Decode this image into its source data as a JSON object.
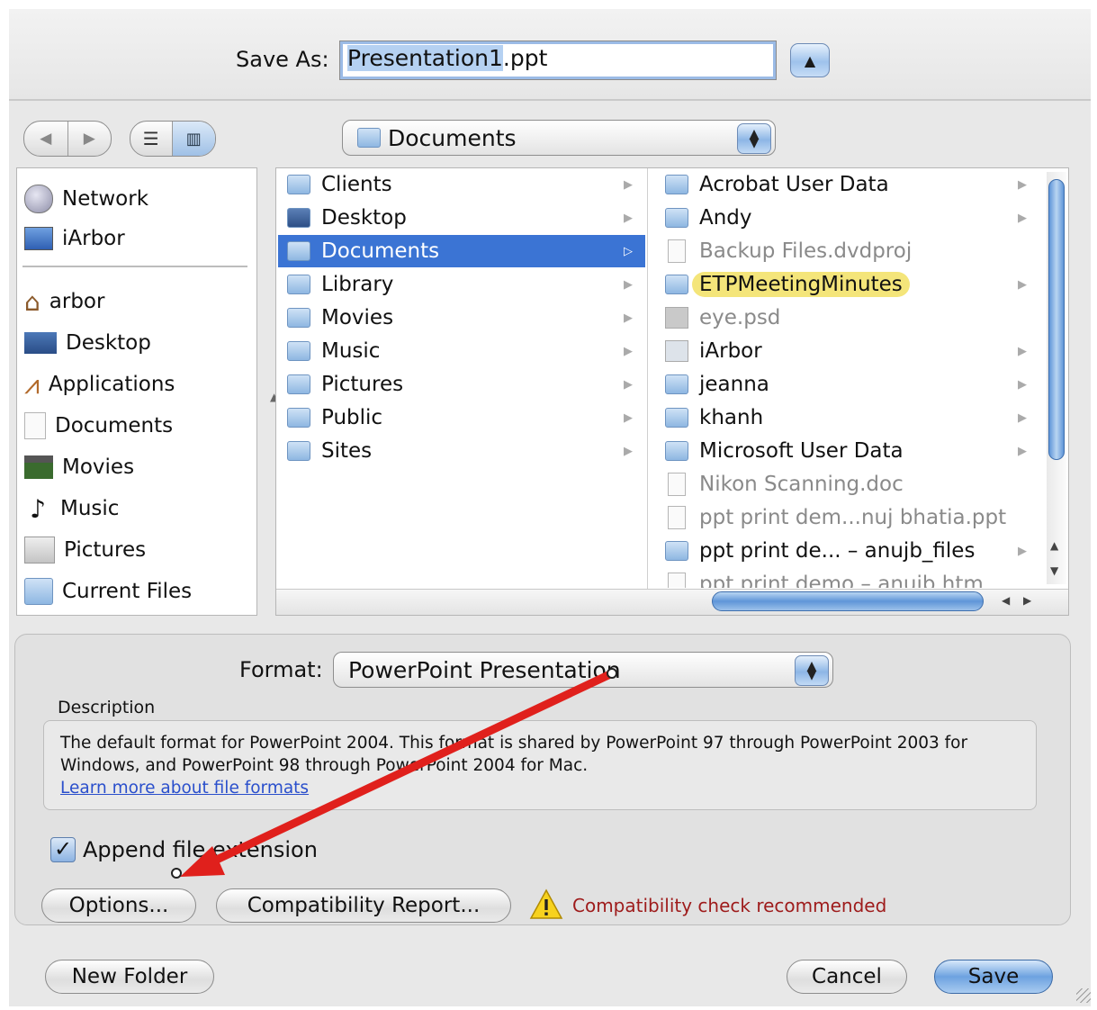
{
  "save_as": {
    "label": "Save As:",
    "filename_selected": "Presentation1",
    "filename_ext": ".ppt",
    "toggle_icon": "triangle-up-icon"
  },
  "toolbar": {
    "back_icon": "back-arrow-icon",
    "forward_icon": "forward-arrow-icon",
    "list_view_icon": "list-view-icon",
    "column_view_icon": "column-view-icon",
    "location": "Documents"
  },
  "sidebar": {
    "devices": [
      "Network",
      "iArbor"
    ],
    "places": [
      "arbor",
      "Desktop",
      "Applications",
      "Documents",
      "Movies",
      "Music",
      "Pictures",
      "Current Files"
    ]
  },
  "browser": {
    "column1": [
      "Clients",
      "Desktop",
      "Documents",
      "Library",
      "Movies",
      "Music",
      "Pictures",
      "Public",
      "Sites"
    ],
    "column1_selected": "Documents",
    "column2": [
      {
        "name": "Acrobat User Data",
        "kind": "folder"
      },
      {
        "name": "Andy",
        "kind": "folder"
      },
      {
        "name": "Backup Files.dvdproj",
        "kind": "file-dim"
      },
      {
        "name": "ETPMeetingMinutes",
        "kind": "folder-labeled"
      },
      {
        "name": "eye.psd",
        "kind": "file-dim"
      },
      {
        "name": "iArbor",
        "kind": "folder"
      },
      {
        "name": "jeanna",
        "kind": "folder"
      },
      {
        "name": "khanh",
        "kind": "folder"
      },
      {
        "name": "Microsoft User Data",
        "kind": "folder"
      },
      {
        "name": "Nikon Scanning.doc",
        "kind": "file-dim"
      },
      {
        "name": "ppt print dem...nuj bhatia.ppt",
        "kind": "file-dim"
      },
      {
        "name": "ppt print de... – anujb_files",
        "kind": "folder"
      },
      {
        "name": "ppt print demo – anujb.htm",
        "kind": "file-dim"
      }
    ]
  },
  "format": {
    "label": "Format:",
    "value": "PowerPoint Presentation",
    "description_label": "Description",
    "description_text": "The default format for PowerPoint 2004. This format is shared by PowerPoint 97 through PowerPoint 2003 for Windows, and PowerPoint 98 through PowerPoint 2004 for Mac.",
    "learn_more": "Learn more about file formats",
    "append_ext_label": "Append file extension",
    "append_ext_checked": true,
    "options_button": "Options...",
    "compat_button": "Compatibility Report...",
    "compat_warning": "Compatibility check recommended",
    "warning_icon": "warning-triangle-icon"
  },
  "footer": {
    "new_folder": "New Folder",
    "cancel": "Cancel",
    "save": "Save"
  },
  "colors": {
    "selection": "#3b74d4",
    "annotation_arrow": "#e0201c",
    "warning_text": "#9e1b1b",
    "label_highlight": "#f4e57a"
  }
}
